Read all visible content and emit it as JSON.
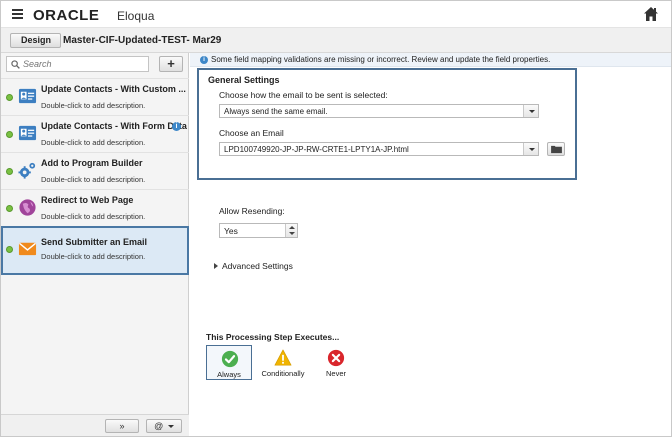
{
  "app": {
    "brand": "ORACLE",
    "product": "Eloqua",
    "menu_icon": "hamburger-menu-icon",
    "home_icon": "home-icon"
  },
  "toolbar": {
    "design_label": "Design",
    "page_title": "Master-CIF-Updated-TEST- Mar29"
  },
  "sidebar": {
    "search_placeholder": "Search",
    "add_label": "+",
    "steps": [
      {
        "title": "Update Contacts - With Custom ...",
        "desc": "Double-click to add description.",
        "icon": "contact-card-icon",
        "status_color": "#7ac142"
      },
      {
        "title": "Update Contacts - With Form Data",
        "desc": "Double-click to add description.",
        "icon": "contact-card-icon",
        "status_color": "#7ac142",
        "info": "i"
      },
      {
        "title": "Add to Program Builder",
        "desc": "Double-click to add description.",
        "icon": "gears-icon",
        "status_color": "#7ac142"
      },
      {
        "title": "Redirect to Web Page",
        "desc": "Double-click to add description.",
        "icon": "globe-redirect-icon",
        "status_color": "#7ac142"
      },
      {
        "title": "Send Submitter an Email",
        "desc": "Double-click to add description.",
        "icon": "envelope-icon",
        "status_color": "#7ac142",
        "selected": true
      }
    ],
    "footer": {
      "expand_label": "»",
      "at_label": "@"
    }
  },
  "main": {
    "alert_text": "Some field mapping validations are missing or incorrect. Review and update the field properties.",
    "general": {
      "title": "General Settings",
      "how_label": "Choose how the email to be sent is selected:",
      "how_value": "Always send the same email.",
      "email_label": "Choose an Email",
      "email_value": "LPD100749920-JP-JP-RW-CRTE1-LPTY1A-JP.html"
    },
    "resend_label": "Allow Resending:",
    "resend_value": "Yes",
    "advanced_label": "Advanced Settings",
    "exec": {
      "title": "This Processing Step Executes...",
      "options": [
        {
          "label": "Always",
          "icon": "check-circle-icon",
          "color": "#4caf50",
          "selected": true
        },
        {
          "label": "Conditionally",
          "icon": "warning-triangle-icon",
          "color": "#f0b400"
        },
        {
          "label": "Never",
          "icon": "x-circle-icon",
          "color": "#d9262c"
        }
      ]
    }
  },
  "colors": {
    "accent_border": "#4a6f94",
    "selected_bg": "#dce9f5",
    "status_green": "#7ac142"
  }
}
